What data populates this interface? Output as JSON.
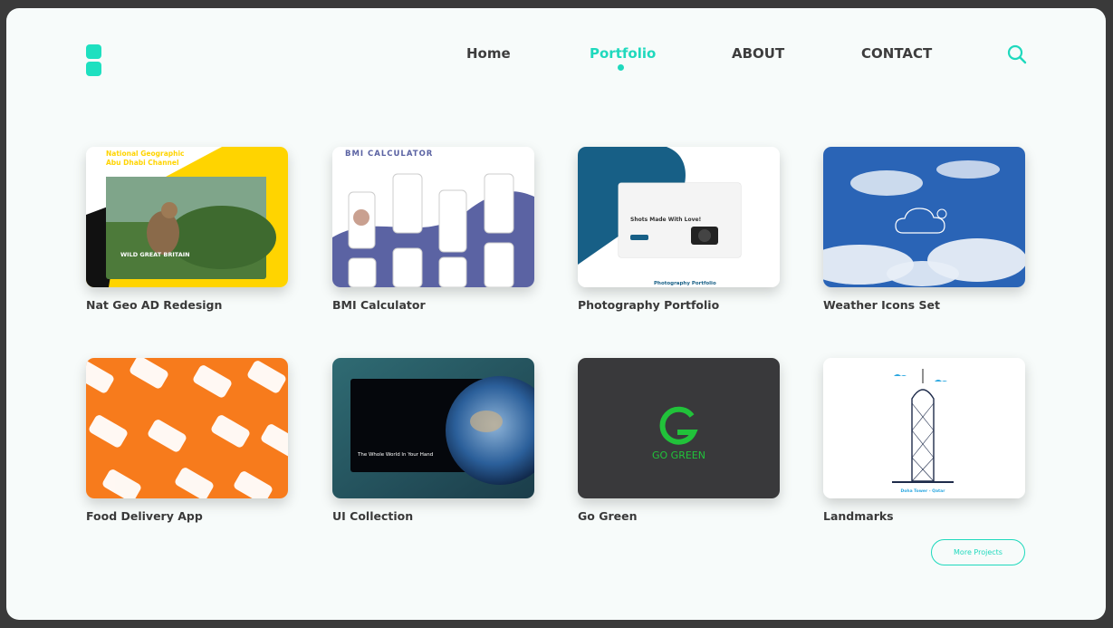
{
  "nav": {
    "home": "Home",
    "portfolio": "Portfolio",
    "about": "ABOUT",
    "contact": "CONTACT",
    "active": "portfolio"
  },
  "icons": {
    "logo": "logo-icon",
    "search": "search-icon"
  },
  "colors": {
    "accent": "#1fd9bd",
    "text": "#3d3d3d",
    "background": "#f7fbfa"
  },
  "projects": [
    {
      "title": "Nat Geo AD Redesign",
      "thumb_text_1": "National Geographic",
      "thumb_text_2": "Abu Dhabi Channel",
      "thumb_text_3": "WILD GREAT BRITAIN"
    },
    {
      "title": "BMI Calculator",
      "thumb_text_1": "BMI CALCULATOR"
    },
    {
      "title": "Photography Portfolio",
      "thumb_text_1": "Shots Made With Love!",
      "thumb_text_2": "Photography Portfolio"
    },
    {
      "title": "Weather Icons Set"
    },
    {
      "title": "Food Delivery App"
    },
    {
      "title": "UI Collection",
      "thumb_text_1": "The Whole World In Your Hand"
    },
    {
      "title": "Go Green",
      "thumb_text_1": "GO GREEN"
    },
    {
      "title": "Landmarks",
      "thumb_text_1": "Doha Tower - Qatar"
    }
  ],
  "more_button": "More Projects"
}
